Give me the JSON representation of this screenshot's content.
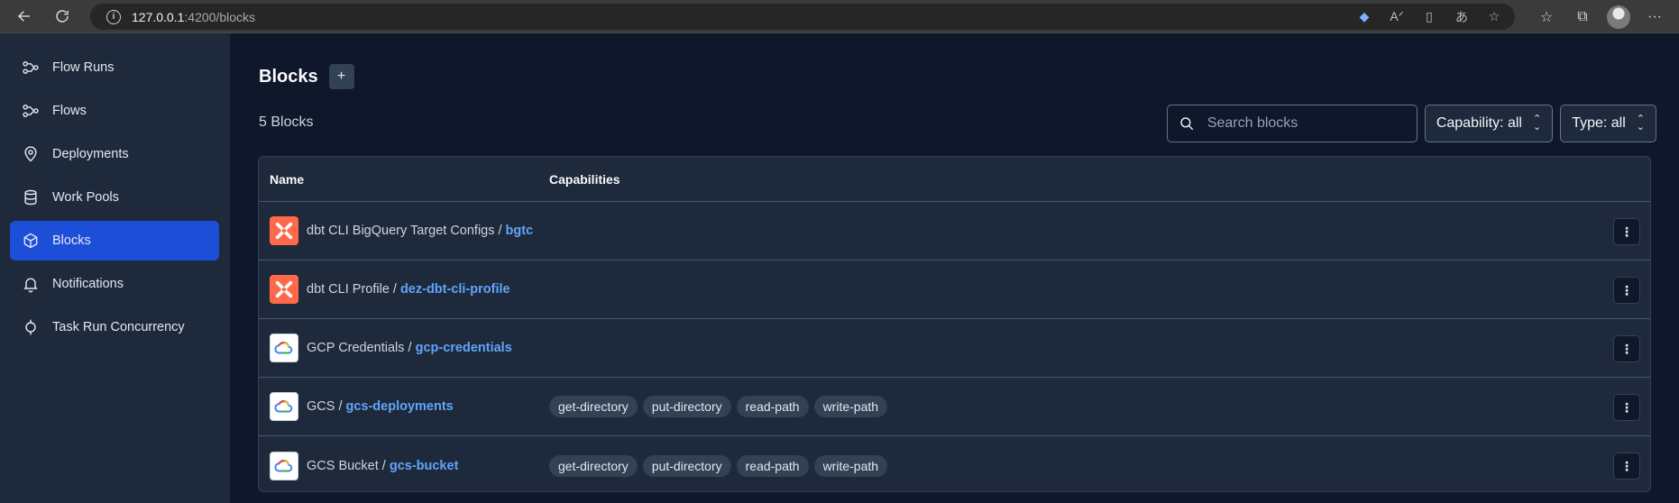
{
  "browser": {
    "url_host": "127.0.0.1",
    "url_path": ":4200/blocks"
  },
  "sidebar": {
    "items": [
      {
        "label": "Flow Runs",
        "icon": "flow-runs-icon"
      },
      {
        "label": "Flows",
        "icon": "flows-icon"
      },
      {
        "label": "Deployments",
        "icon": "map-pin-icon"
      },
      {
        "label": "Work Pools",
        "icon": "database-icon"
      },
      {
        "label": "Blocks",
        "icon": "cube-icon",
        "active": true
      },
      {
        "label": "Notifications",
        "icon": "bell-icon"
      },
      {
        "label": "Task Run Concurrency",
        "icon": "concurrency-icon"
      }
    ]
  },
  "main": {
    "title": "Blocks",
    "add_label": "+",
    "count": "5 Blocks",
    "search_placeholder": "Search blocks",
    "capability_filter": "Capability: all",
    "type_filter": "Type: all",
    "columns": [
      "Name",
      "Capabilities"
    ],
    "rows": [
      {
        "type": "dbt CLI BigQuery Target Configs /",
        "name": "bgtc",
        "logo": "dbt",
        "capabilities": []
      },
      {
        "type": "dbt CLI Profile /",
        "name": "dez-dbt-cli-profile",
        "logo": "dbt",
        "capabilities": []
      },
      {
        "type": "GCP Credentials /",
        "name": "gcp-credentials",
        "logo": "gcp",
        "capabilities": []
      },
      {
        "type": "GCS /",
        "name": "gcs-deployments",
        "logo": "gcp",
        "capabilities": [
          "get-directory",
          "put-directory",
          "read-path",
          "write-path"
        ]
      },
      {
        "type": "GCS Bucket /",
        "name": "gcs-bucket",
        "logo": "gcp",
        "capabilities": [
          "get-directory",
          "put-directory",
          "read-path",
          "write-path"
        ]
      }
    ]
  },
  "colors": {
    "accent": "#1d4ed8",
    "link": "#60a5fa",
    "dbt": "#ff694a"
  }
}
